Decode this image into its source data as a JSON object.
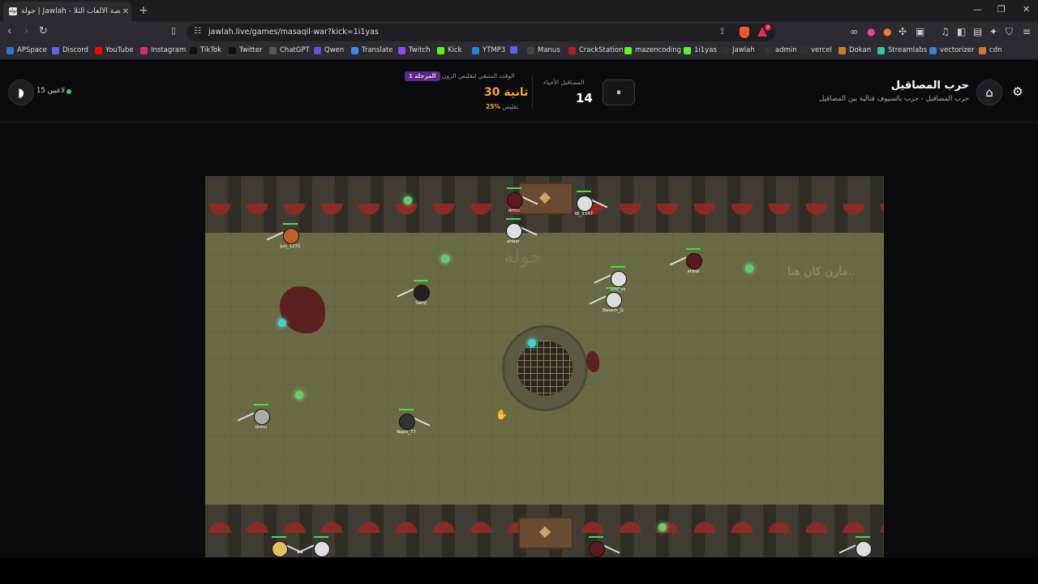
{
  "browser": {
    "tab_title": "جولة | Jawlah - منصة الألعاب الثلا",
    "favicon_text": "جولة",
    "url": "jawlah.live/games/masaqil-war?kick=1i1yas",
    "bookmarks": [
      {
        "label": "APSpace",
        "color": "#3a6fd8"
      },
      {
        "label": "Discord",
        "color": "#5865f2"
      },
      {
        "label": "YouTube",
        "color": "#ff0000"
      },
      {
        "label": "Instagram",
        "color": "#d62976"
      },
      {
        "label": "TikTok",
        "color": "#111111"
      },
      {
        "label": "Twitter",
        "color": "#111111"
      },
      {
        "label": "ChatGPT",
        "color": "#555555"
      },
      {
        "label": "Qwen",
        "color": "#6b4ce6"
      },
      {
        "label": "Translate",
        "color": "#4285f4"
      },
      {
        "label": "Twitch",
        "color": "#9146ff"
      },
      {
        "label": "Kick",
        "color": "#53fc18"
      },
      {
        "label": "YTMP3",
        "color": "#1e88e5"
      },
      {
        "label": "",
        "color": "#5865f2"
      },
      {
        "label": "Manus",
        "color": "#444444"
      },
      {
        "label": "CrackStation",
        "color": "#b71c1c"
      },
      {
        "label": "mazencoding",
        "color": "#53fc18"
      },
      {
        "label": "1i1yas",
        "color": "#53fc18"
      },
      {
        "label": "Jawlah",
        "color": "#333333"
      },
      {
        "label": "admin",
        "color": "#333333"
      },
      {
        "label": "vercel",
        "color": "#333333"
      },
      {
        "label": "Dokan",
        "color": "#c97b2a"
      },
      {
        "label": "Streamlabs",
        "color": "#31c3a2"
      },
      {
        "label": "vectorizer",
        "color": "#3a7bd5"
      },
      {
        "label": "cdn",
        "color": "#c97b2a"
      }
    ],
    "red_badge": "2"
  },
  "header": {
    "game_title": "حرب المصاقيل",
    "game_subtitle": "حرب المصاقيل - حرب بالسيوف قتالية بين المصاقيل",
    "alive_label": "المصاقيل الأحياء",
    "alive_count": "14",
    "pause_icon": "⏸",
    "stage_label": "المرحلة 1",
    "zone_label": "الوقت المتبقي لتقليص الزون",
    "zone_time": "30 ثانية",
    "zone_pct": "25%",
    "zone_pct_suffix": "تقليص",
    "players_online": "15 لاعبين"
  },
  "arena": {
    "watermark": "مازن كان هنا..",
    "logo_watermark": "جولة",
    "players": [
      {
        "name": "Jun_1231"
      },
      {
        "name": "drmu"
      },
      {
        "name": "W_3347"
      },
      {
        "name": "ahbar"
      },
      {
        "name": "Samj"
      },
      {
        "name": "ahbal"
      },
      {
        "name": "sha_ss"
      },
      {
        "name": "Basem_G"
      },
      {
        "name": "drmu"
      },
      {
        "name": "Najie_77"
      },
      {
        "name": ""
      },
      {
        "name": ""
      },
      {
        "name": ""
      },
      {
        "name": ""
      }
    ]
  }
}
